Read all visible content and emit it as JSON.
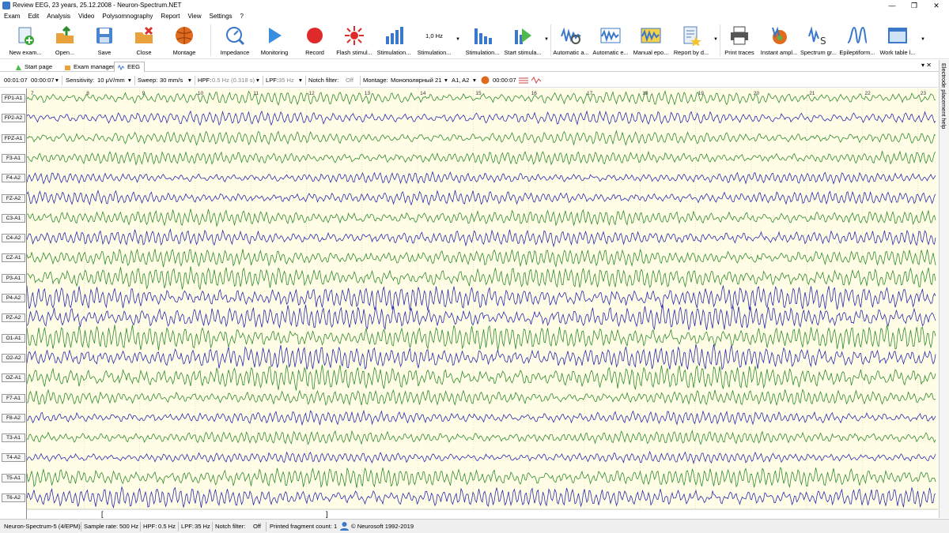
{
  "window": {
    "title": "Review EEG, 23 years, 25.12.2008 - Neuron-Spectrum.NET",
    "minimize": "—",
    "maximize": "❐",
    "close": "✕"
  },
  "menu": [
    "Exam",
    "Edit",
    "Analysis",
    "Video",
    "Polysomnography",
    "Report",
    "View",
    "Settings",
    "?"
  ],
  "ribbon": [
    {
      "label": "New exam...",
      "icon": "new-exam-icon"
    },
    {
      "label": "Open...",
      "icon": "open-icon"
    },
    {
      "label": "Save",
      "icon": "save-icon"
    },
    {
      "label": "Close",
      "icon": "close-exam-icon"
    },
    {
      "label": "Montage",
      "icon": "montage-head-icon"
    },
    {
      "label": "Impedance",
      "icon": "impedance-icon"
    },
    {
      "label": "Monitoring",
      "icon": "play-icon"
    },
    {
      "label": "Record",
      "icon": "record-icon"
    },
    {
      "label": "Flash stimul...",
      "icon": "flash-icon"
    },
    {
      "label": "Stimulation...",
      "icon": "bars-icon"
    },
    {
      "label": "Stimulation...",
      "icon": "frequency-icon",
      "caption": "1,0 Hz"
    },
    {
      "label": "Stimulation...",
      "icon": "bars-icon"
    },
    {
      "label": "Start stimula...",
      "icon": "start-stim-icon"
    },
    {
      "label": "Automatic a...",
      "icon": "auto-analysis-icon"
    },
    {
      "label": "Automatic e...",
      "icon": "auto-epoch-icon"
    },
    {
      "label": "Manual epo...",
      "icon": "manual-epoch-icon"
    },
    {
      "label": "Report by d...",
      "icon": "report-icon"
    },
    {
      "label": "Print traces",
      "icon": "printer-icon"
    },
    {
      "label": "Instant ampl...",
      "icon": "instant-ampl-icon"
    },
    {
      "label": "Spectrum gr...",
      "icon": "spectrum-icon"
    },
    {
      "label": "Epileptiform...",
      "icon": "epileptiform-icon"
    },
    {
      "label": "Work table l...",
      "icon": "work-table-icon"
    }
  ],
  "tabs": [
    {
      "label": "Start page"
    },
    {
      "label": "Exam manager"
    },
    {
      "label": "EEG"
    }
  ],
  "side_panel": "Electrode placement help",
  "toolbar": {
    "time_start": "00:01:07",
    "time_end": "00:00:07",
    "sensitivity_label": "Sensitivity:",
    "sensitivity": "10 μV/mm",
    "sweep_label": "Sweep:",
    "sweep": "30 mm/s",
    "hpf_label": "HPF:",
    "hpf": "0.5 Hz (0.318 s)",
    "lpf_label": "LPF:",
    "lpf": "35 Hz",
    "notch_label": "Notch filter:",
    "notch": "Off",
    "montage_label": "Montage:",
    "montage": "Монополярный 21",
    "reference": "A1, A2",
    "cursor_time": "00:00:07"
  },
  "time_marks": [
    "7",
    "8",
    "9",
    "10",
    "11",
    "12",
    "13",
    "14",
    "15",
    "16",
    "17",
    "18",
    "19",
    "20",
    "21",
    "22",
    "23"
  ],
  "channels": [
    {
      "name": "FP1-A1",
      "color": "#2e8b2e",
      "amp": 6,
      "freq": 9
    },
    {
      "name": "FP2-A2",
      "color": "#2a2ab0",
      "amp": 6,
      "freq": 9
    },
    {
      "name": "FPZ-A1",
      "color": "#2e8b2e",
      "amp": 6,
      "freq": 9
    },
    {
      "name": "F3-A1",
      "color": "#2e8b2e",
      "amp": 6,
      "freq": 10
    },
    {
      "name": "F4-A2",
      "color": "#2a2ab0",
      "amp": 5,
      "freq": 10
    },
    {
      "name": "FZ-A2",
      "color": "#2a2ab0",
      "amp": 6,
      "freq": 10
    },
    {
      "name": "C3-A1",
      "color": "#2e8b2e",
      "amp": 7,
      "freq": 10
    },
    {
      "name": "C4-A2",
      "color": "#2a2ab0",
      "amp": 7,
      "freq": 10
    },
    {
      "name": "CZ-A1",
      "color": "#2e8b2e",
      "amp": 8,
      "freq": 10
    },
    {
      "name": "P3-A1",
      "color": "#2e8b2e",
      "amp": 10,
      "freq": 10
    },
    {
      "name": "P4-A2",
      "color": "#2a2ab0",
      "amp": 11,
      "freq": 10
    },
    {
      "name": "PZ-A2",
      "color": "#2a2ab0",
      "amp": 11,
      "freq": 10
    },
    {
      "name": "O1-A1",
      "color": "#2e8b2e",
      "amp": 11,
      "freq": 10
    },
    {
      "name": "O2-A2",
      "color": "#2a2ab0",
      "amp": 11,
      "freq": 10
    },
    {
      "name": "OZ-A1",
      "color": "#2e8b2e",
      "amp": 11,
      "freq": 10
    },
    {
      "name": "F7-A1",
      "color": "#2e8b2e",
      "amp": 7,
      "freq": 10
    },
    {
      "name": "F8-A2",
      "color": "#2a2ab0",
      "amp": 6,
      "freq": 10
    },
    {
      "name": "T3-A1",
      "color": "#2e8b2e",
      "amp": 6,
      "freq": 10
    },
    {
      "name": "T4-A2",
      "color": "#2a2ab0",
      "amp": 5,
      "freq": 10
    },
    {
      "name": "T5-A1",
      "color": "#2e8b2e",
      "amp": 9,
      "freq": 10
    },
    {
      "name": "T6-A2",
      "color": "#2a2ab0",
      "amp": 9,
      "freq": 10
    }
  ],
  "status": {
    "device": "Neuron-Spectrum-5 (4/EPM)",
    "sample_rate_label": "Sample rate:",
    "sample_rate": "500 Hz",
    "hpf_label": "HPF:",
    "hpf": "0.5 Hz",
    "lpf_label": "LPF:",
    "lpf": "35 Hz",
    "notch_label": "Notch filter:",
    "notch": "Off",
    "printed_label": "Printed fragment count:",
    "printed_count": "1",
    "copyright": "© Neurosoft 1992-2019"
  },
  "colors": {
    "green_trace": "#2e8b2e",
    "blue_trace": "#2a2ab0",
    "trace_bg": "#fffde6"
  }
}
